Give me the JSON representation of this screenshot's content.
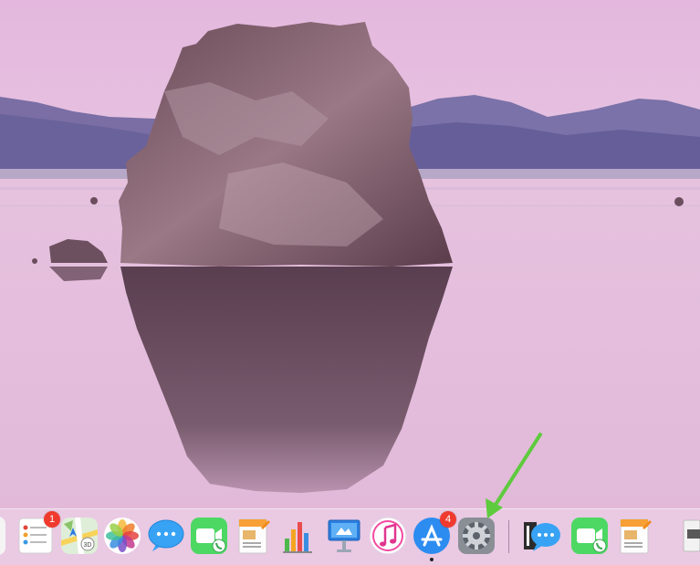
{
  "desktop": {
    "wallpaper": "mono-lake-tufa-pink"
  },
  "dock": {
    "items": [
      {
        "name": "finder-partial",
        "icon": "finder-icon"
      },
      {
        "name": "reminders",
        "icon": "reminders-icon",
        "badge": "1"
      },
      {
        "name": "maps",
        "icon": "maps-icon"
      },
      {
        "name": "photos",
        "icon": "photos-icon"
      },
      {
        "name": "messages",
        "icon": "messages-icon"
      },
      {
        "name": "facetime",
        "icon": "facetime-icon"
      },
      {
        "name": "pages",
        "icon": "pages-icon"
      },
      {
        "name": "numbers",
        "icon": "numbers-icon"
      },
      {
        "name": "keynote",
        "icon": "keynote-icon"
      },
      {
        "name": "itunes",
        "icon": "itunes-icon"
      },
      {
        "name": "app-store",
        "icon": "app-store-icon",
        "badge": "4",
        "running": true
      },
      {
        "name": "system-preferences",
        "icon": "gear-icon"
      },
      {
        "name": "messages-recent",
        "icon": "messages-icon"
      },
      {
        "name": "facetime-recent",
        "icon": "facetime-icon"
      },
      {
        "name": "pages-recent",
        "icon": "pages-icon"
      },
      {
        "name": "downloads-stack",
        "icon": "folder-stack-icon"
      }
    ]
  },
  "annotation": {
    "arrow_color": "#5ecb3e",
    "target": "system-preferences"
  }
}
